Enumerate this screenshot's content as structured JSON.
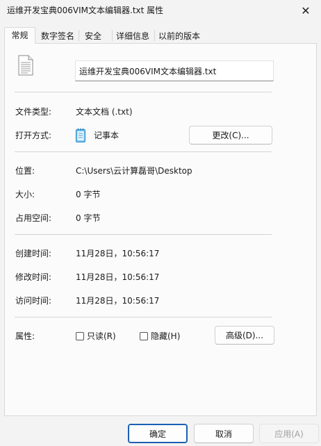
{
  "window": {
    "title": "运维开发宝典006VIM文本编辑器.txt 属性",
    "close_glyph": "✕"
  },
  "tabs": [
    {
      "label": "常规",
      "active": true
    },
    {
      "label": "数字签名",
      "active": false
    },
    {
      "label": "安全",
      "active": false
    },
    {
      "label": "详细信息",
      "active": false
    },
    {
      "label": "以前的版本",
      "active": false
    }
  ],
  "general": {
    "file_icon": "text-document-icon",
    "filename": "运维开发宝典006VIM文本编辑器.txt",
    "type_label": "文件类型:",
    "type_value": "文本文档 (.txt)",
    "opens_with_label": "打开方式:",
    "opens_with_icon": "notepad-icon",
    "opens_with_value": "记事本",
    "change_button": "更改(C)...",
    "location_label": "位置:",
    "location_value": "C:\\Users\\云计算磊哥\\Desktop",
    "size_label": "大小:",
    "size_value": "0 字节",
    "size_on_disk_label": "占用空间:",
    "size_on_disk_value": "0 字节",
    "created_label": "创建时间:",
    "created_value": "11月28日，10:56:17",
    "modified_label": "修改时间:",
    "modified_value": "11月28日，10:56:17",
    "accessed_label": "访问时间:",
    "accessed_value": "11月28日，10:56:17",
    "attributes_label": "属性:",
    "readonly_label": "只读(R)",
    "readonly_checked": false,
    "hidden_label": "隐藏(H)",
    "hidden_checked": false,
    "advanced_button": "高级(D)..."
  },
  "footer": {
    "ok_button": "确定",
    "cancel_button": "取消",
    "apply_button": "应用(A)"
  },
  "colors": {
    "accent": "#1a5fb4",
    "panel_bg": "#fbfbfb",
    "window_bg": "#f3f3f3"
  }
}
